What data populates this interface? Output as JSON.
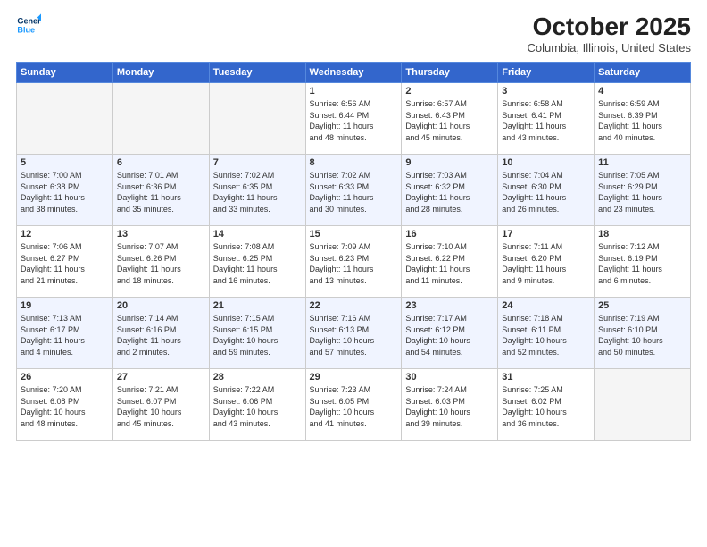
{
  "header": {
    "logo_line1": "General",
    "logo_line2": "Blue",
    "month": "October 2025",
    "location": "Columbia, Illinois, United States"
  },
  "weekdays": [
    "Sunday",
    "Monday",
    "Tuesday",
    "Wednesday",
    "Thursday",
    "Friday",
    "Saturday"
  ],
  "weeks": [
    [
      {
        "day": "",
        "info": ""
      },
      {
        "day": "",
        "info": ""
      },
      {
        "day": "",
        "info": ""
      },
      {
        "day": "1",
        "info": "Sunrise: 6:56 AM\nSunset: 6:44 PM\nDaylight: 11 hours\nand 48 minutes."
      },
      {
        "day": "2",
        "info": "Sunrise: 6:57 AM\nSunset: 6:43 PM\nDaylight: 11 hours\nand 45 minutes."
      },
      {
        "day": "3",
        "info": "Sunrise: 6:58 AM\nSunset: 6:41 PM\nDaylight: 11 hours\nand 43 minutes."
      },
      {
        "day": "4",
        "info": "Sunrise: 6:59 AM\nSunset: 6:39 PM\nDaylight: 11 hours\nand 40 minutes."
      }
    ],
    [
      {
        "day": "5",
        "info": "Sunrise: 7:00 AM\nSunset: 6:38 PM\nDaylight: 11 hours\nand 38 minutes."
      },
      {
        "day": "6",
        "info": "Sunrise: 7:01 AM\nSunset: 6:36 PM\nDaylight: 11 hours\nand 35 minutes."
      },
      {
        "day": "7",
        "info": "Sunrise: 7:02 AM\nSunset: 6:35 PM\nDaylight: 11 hours\nand 33 minutes."
      },
      {
        "day": "8",
        "info": "Sunrise: 7:02 AM\nSunset: 6:33 PM\nDaylight: 11 hours\nand 30 minutes."
      },
      {
        "day": "9",
        "info": "Sunrise: 7:03 AM\nSunset: 6:32 PM\nDaylight: 11 hours\nand 28 minutes."
      },
      {
        "day": "10",
        "info": "Sunrise: 7:04 AM\nSunset: 6:30 PM\nDaylight: 11 hours\nand 26 minutes."
      },
      {
        "day": "11",
        "info": "Sunrise: 7:05 AM\nSunset: 6:29 PM\nDaylight: 11 hours\nand 23 minutes."
      }
    ],
    [
      {
        "day": "12",
        "info": "Sunrise: 7:06 AM\nSunset: 6:27 PM\nDaylight: 11 hours\nand 21 minutes."
      },
      {
        "day": "13",
        "info": "Sunrise: 7:07 AM\nSunset: 6:26 PM\nDaylight: 11 hours\nand 18 minutes."
      },
      {
        "day": "14",
        "info": "Sunrise: 7:08 AM\nSunset: 6:25 PM\nDaylight: 11 hours\nand 16 minutes."
      },
      {
        "day": "15",
        "info": "Sunrise: 7:09 AM\nSunset: 6:23 PM\nDaylight: 11 hours\nand 13 minutes."
      },
      {
        "day": "16",
        "info": "Sunrise: 7:10 AM\nSunset: 6:22 PM\nDaylight: 11 hours\nand 11 minutes."
      },
      {
        "day": "17",
        "info": "Sunrise: 7:11 AM\nSunset: 6:20 PM\nDaylight: 11 hours\nand 9 minutes."
      },
      {
        "day": "18",
        "info": "Sunrise: 7:12 AM\nSunset: 6:19 PM\nDaylight: 11 hours\nand 6 minutes."
      }
    ],
    [
      {
        "day": "19",
        "info": "Sunrise: 7:13 AM\nSunset: 6:17 PM\nDaylight: 11 hours\nand 4 minutes."
      },
      {
        "day": "20",
        "info": "Sunrise: 7:14 AM\nSunset: 6:16 PM\nDaylight: 11 hours\nand 2 minutes."
      },
      {
        "day": "21",
        "info": "Sunrise: 7:15 AM\nSunset: 6:15 PM\nDaylight: 10 hours\nand 59 minutes."
      },
      {
        "day": "22",
        "info": "Sunrise: 7:16 AM\nSunset: 6:13 PM\nDaylight: 10 hours\nand 57 minutes."
      },
      {
        "day": "23",
        "info": "Sunrise: 7:17 AM\nSunset: 6:12 PM\nDaylight: 10 hours\nand 54 minutes."
      },
      {
        "day": "24",
        "info": "Sunrise: 7:18 AM\nSunset: 6:11 PM\nDaylight: 10 hours\nand 52 minutes."
      },
      {
        "day": "25",
        "info": "Sunrise: 7:19 AM\nSunset: 6:10 PM\nDaylight: 10 hours\nand 50 minutes."
      }
    ],
    [
      {
        "day": "26",
        "info": "Sunrise: 7:20 AM\nSunset: 6:08 PM\nDaylight: 10 hours\nand 48 minutes."
      },
      {
        "day": "27",
        "info": "Sunrise: 7:21 AM\nSunset: 6:07 PM\nDaylight: 10 hours\nand 45 minutes."
      },
      {
        "day": "28",
        "info": "Sunrise: 7:22 AM\nSunset: 6:06 PM\nDaylight: 10 hours\nand 43 minutes."
      },
      {
        "day": "29",
        "info": "Sunrise: 7:23 AM\nSunset: 6:05 PM\nDaylight: 10 hours\nand 41 minutes."
      },
      {
        "day": "30",
        "info": "Sunrise: 7:24 AM\nSunset: 6:03 PM\nDaylight: 10 hours\nand 39 minutes."
      },
      {
        "day": "31",
        "info": "Sunrise: 7:25 AM\nSunset: 6:02 PM\nDaylight: 10 hours\nand 36 minutes."
      },
      {
        "day": "",
        "info": ""
      }
    ]
  ]
}
